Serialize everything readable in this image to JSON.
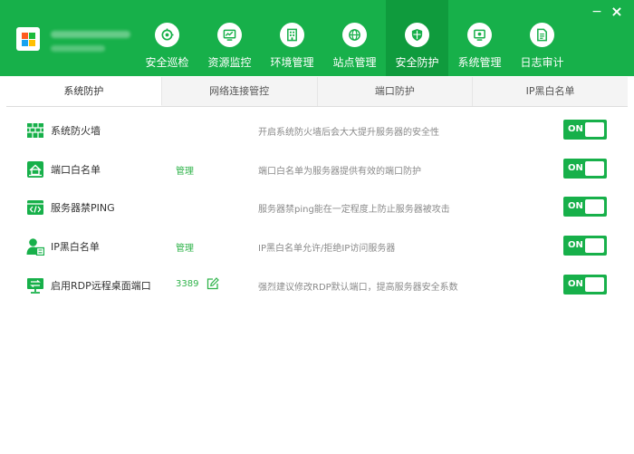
{
  "header": {
    "nav": [
      {
        "label": "安全巡检",
        "icon": "scan-icon"
      },
      {
        "label": "资源监控",
        "icon": "monitor-chart-icon"
      },
      {
        "label": "环境管理",
        "icon": "building-icon"
      },
      {
        "label": "站点管理",
        "icon": "globe-icon"
      },
      {
        "label": "安全防护",
        "icon": "shield-icon"
      },
      {
        "label": "系统管理",
        "icon": "system-gear-icon"
      },
      {
        "label": "日志审计",
        "icon": "document-icon"
      }
    ],
    "active_nav": 4,
    "minimize": "−",
    "close": "×"
  },
  "tabs": [
    {
      "label": "系统防护"
    },
    {
      "label": "网络连接管控"
    },
    {
      "label": "端口防护"
    },
    {
      "label": "IP黑白名单"
    }
  ],
  "active_tab": 0,
  "rows": [
    {
      "title": "系统防火墙",
      "link": "",
      "desc": "开启系统防火墙后会大大提升服务器的安全性",
      "toggle": "ON",
      "icon": "firewall-icon"
    },
    {
      "title": "端口白名单",
      "link": "管理",
      "desc": "端口白名单为服务器提供有效的端口防护",
      "toggle": "ON",
      "icon": "port-whitelist-icon"
    },
    {
      "title": "服务器禁PING",
      "link": "",
      "desc": "服务器禁ping能在一定程度上防止服务器被攻击",
      "toggle": "ON",
      "icon": "code-icon"
    },
    {
      "title": "IP黑白名单",
      "link": "管理",
      "desc": "IP黑白名单允许/拒绝IP访问服务器",
      "toggle": "ON",
      "icon": "user-list-icon"
    },
    {
      "title": "启用RDP远程桌面端口",
      "port": "3389",
      "desc": "强烈建议修改RDP默认端口，提高服务器安全系数",
      "toggle": "ON",
      "icon": "rdp-icon"
    }
  ],
  "colors": {
    "accent": "#17b04a",
    "accent_dark": "#0f9b3d",
    "link": "#2fb34a"
  }
}
